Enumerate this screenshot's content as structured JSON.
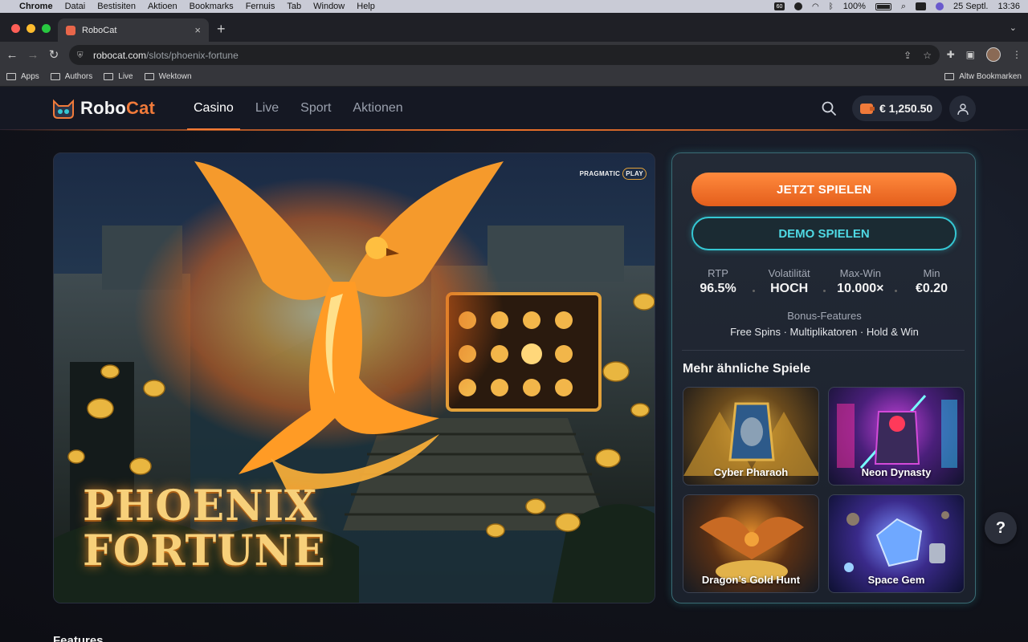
{
  "os_menu": {
    "app_name": "Chrome",
    "items": [
      "Datai",
      "Bestisiten",
      "Aktioen",
      "Bookmarks",
      "Fernuis",
      "Tab",
      "Window",
      "Help"
    ],
    "battery": "100%",
    "date": "25 Septl.",
    "time": "13:36",
    "badge": "60"
  },
  "browser": {
    "tab_title": "RoboCat",
    "url_host": "robocat.com",
    "url_path": "/slots/phoenix-fortune",
    "bookmarks": [
      "Apps",
      "Authors",
      "Live",
      "Wektown"
    ],
    "other_bookmarks": "Altw Bookmarken"
  },
  "site": {
    "logo_part1": "Robo",
    "logo_part2": "Cat",
    "nav": [
      "Casino",
      "Live",
      "Sport",
      "Aktionen"
    ],
    "balance": "€ 1,250.50"
  },
  "hero": {
    "provider": "PRAGMATIC",
    "provider_badge": "PLAY",
    "title_line1": "PHOENIX",
    "title_line2": "FORTUNE"
  },
  "panel": {
    "play_label": "JETZT SPIELEN",
    "demo_label": "DEMO SPIELEN",
    "stats": [
      {
        "label": "RTP",
        "value": "96.5%"
      },
      {
        "label": "Volatilität",
        "value": "HOCH"
      },
      {
        "label": "Max-Win",
        "value": "10.000×"
      },
      {
        "label": "Min",
        "value": "€0.20"
      }
    ],
    "bonus_heading": "Bonus-Features",
    "bonus_values": "Free Spins · Multiplikatoren · Hold & Win",
    "more_heading": "Mehr ähnliche Spiele",
    "similar": [
      "Cyber Pharaoh",
      "Neon Dynasty",
      "Dragon’s Gold Hunt",
      "Space Gem"
    ]
  },
  "features_heading": "Features",
  "help_label": "?",
  "colors": {
    "accent_orange": "#f07a3a",
    "accent_cyan": "#35c7d3",
    "background": "#11131b"
  }
}
